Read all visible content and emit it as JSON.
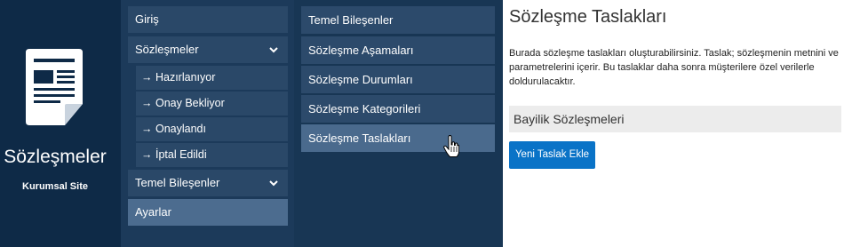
{
  "brand": {
    "title": "Sözleşmeler",
    "subtitle": "Kurumsal Site",
    "icon": "document-icon"
  },
  "nav_main": {
    "items": [
      {
        "label": "Giriş"
      },
      {
        "label": "Sözleşmeler",
        "expanded": true,
        "icon": "chevron-down-icon"
      },
      {
        "label": "→ Hazırlanıyor"
      },
      {
        "label": "→ Onay Bekliyor"
      },
      {
        "label": "→ Onaylandı"
      },
      {
        "label": "→ İptal Edildi"
      },
      {
        "label": "Temel Bileşenler",
        "icon": "chevron-down-icon"
      },
      {
        "label": "Ayarlar",
        "active": true
      }
    ]
  },
  "nav_sub": {
    "items": [
      {
        "label": "Temel Bileşenler"
      },
      {
        "label": "Sözleşme Aşamaları"
      },
      {
        "label": "Sözleşme Durumları"
      },
      {
        "label": "Sözleşme Kategorileri"
      },
      {
        "label": "Sözleşme Taslakları",
        "active": true
      }
    ]
  },
  "content": {
    "title": "Sözleşme Taslakları",
    "description": "Burada sözleşme taslakları oluşturabilirsiniz. Taslak; sözleşmenin metnini ve parametrelerini içerir. Bu taslaklar daha sonra müşterilere özel verilerle doldurulacaktır.",
    "panel_title": "Bayilik Sözleşmeleri",
    "new_button": "Yeni Taslak Ekle"
  },
  "colors": {
    "brand_bg": "#0e2a47",
    "nav_bg": "#1c3a5a",
    "nav_item": "#2a4868",
    "nav_active": "#4c6c8f",
    "button": "#0a73c7"
  }
}
